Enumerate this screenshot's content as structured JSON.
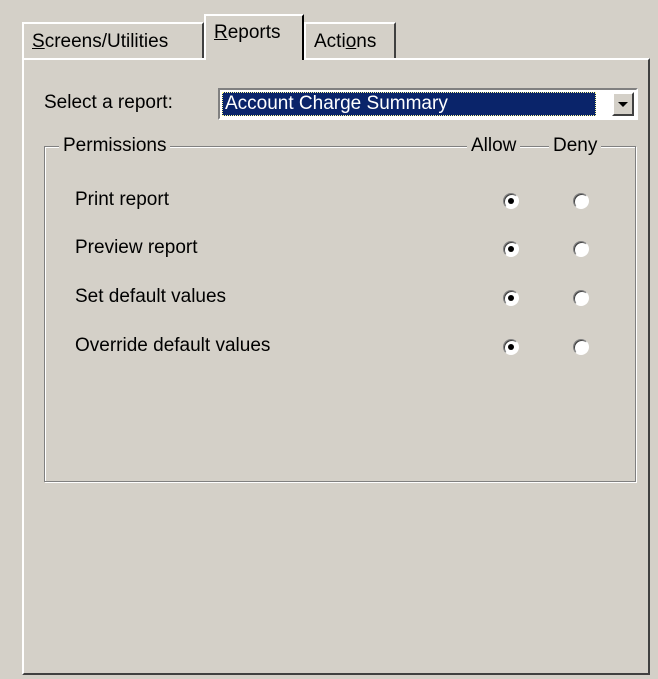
{
  "tabs": [
    {
      "label_pre": "",
      "mnemonic": "S",
      "label_post": "creens/Utilities"
    },
    {
      "label_pre": "",
      "mnemonic": "R",
      "label_post": "eports"
    },
    {
      "label_pre": "Acti",
      "mnemonic": "o",
      "label_post": "ns"
    }
  ],
  "active_tab": "Reports",
  "report_select": {
    "label": "Select a report:",
    "value": "Account Charge Summary"
  },
  "permissions": {
    "group_label": "Permissions",
    "allow_label": "Allow",
    "deny_label": "Deny",
    "rows": [
      {
        "label": "Print report",
        "selected": "allow"
      },
      {
        "label": "Preview report",
        "selected": "allow"
      },
      {
        "label": "Set default values",
        "selected": "allow"
      },
      {
        "label": "Override default values",
        "selected": "allow"
      }
    ]
  },
  "colors": {
    "face": "#d4d0c8",
    "selection": "#0a246a"
  }
}
